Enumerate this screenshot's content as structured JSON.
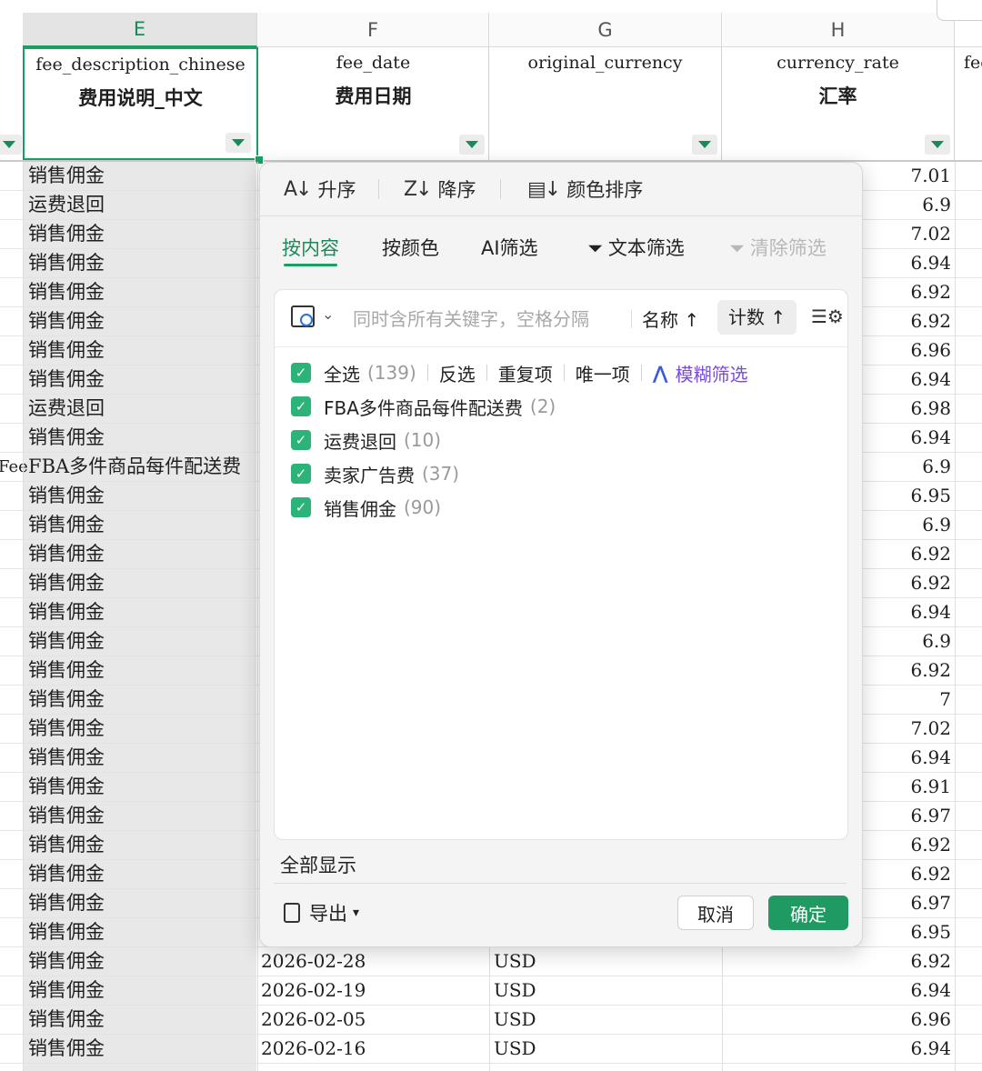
{
  "columns": {
    "E": {
      "letter": "E",
      "en": "fee_description_chinese",
      "zh": "费用说明_中文"
    },
    "F": {
      "letter": "F",
      "en": "fee_date",
      "zh": "费用日期"
    },
    "G": {
      "letter": "G",
      "en": "original_currency",
      "zh": ""
    },
    "H": {
      "letter": "H",
      "en": "currency_rate",
      "zh": "汇率"
    },
    "I": {
      "letter": "",
      "en": "fee"
    }
  },
  "rows": [
    {
      "e": "销售佣金",
      "h": "7.01"
    },
    {
      "e": "运费退回",
      "h": "6.9"
    },
    {
      "e": "销售佣金",
      "h": "7.02"
    },
    {
      "e": "销售佣金",
      "h": "6.94"
    },
    {
      "e": "销售佣金",
      "h": "6.92"
    },
    {
      "e": "销售佣金",
      "h": "6.92"
    },
    {
      "e": "销售佣金",
      "h": "6.96"
    },
    {
      "e": "销售佣金",
      "h": "6.94"
    },
    {
      "e": "运费退回",
      "h": "6.98"
    },
    {
      "e": "销售佣金",
      "h": "6.94"
    },
    {
      "a": "Fee",
      "e": "FBA多件商品每件配送费",
      "h": "6.9"
    },
    {
      "e": "销售佣金",
      "h": "6.95"
    },
    {
      "e": "销售佣金",
      "h": "6.9"
    },
    {
      "e": "销售佣金",
      "h": "6.92"
    },
    {
      "e": "销售佣金",
      "h": "6.92"
    },
    {
      "e": "销售佣金",
      "h": "6.94"
    },
    {
      "e": "销售佣金",
      "h": "6.9"
    },
    {
      "e": "销售佣金",
      "h": "6.92"
    },
    {
      "e": "销售佣金",
      "h": "7"
    },
    {
      "e": "销售佣金",
      "h": "7.02"
    },
    {
      "e": "销售佣金",
      "h": "6.94"
    },
    {
      "e": "销售佣金",
      "h": "6.91"
    },
    {
      "e": "销售佣金",
      "h": "6.97"
    },
    {
      "e": "销售佣金",
      "h": "6.92"
    },
    {
      "e": "销售佣金",
      "h": "6.92"
    },
    {
      "e": "销售佣金",
      "h": "6.97"
    },
    {
      "e": "销售佣金",
      "h": "6.95"
    },
    {
      "e": "销售佣金",
      "f": "2026-02-28",
      "g": "USD",
      "h": "6.92"
    },
    {
      "e": "销售佣金",
      "f": "2026-02-19",
      "g": "USD",
      "h": "6.94"
    },
    {
      "e": "销售佣金",
      "f": "2026-02-05",
      "g": "USD",
      "h": "6.96"
    },
    {
      "e": "销售佣金",
      "f": "2026-02-16",
      "g": "USD",
      "h": "6.94"
    }
  ],
  "filter_panel": {
    "sort_asc": "升序",
    "sort_desc": "降序",
    "sort_color": "颜色排序",
    "tabs": {
      "by_content": "按内容",
      "by_color": "按颜色",
      "ai_filter": "AI筛选",
      "text_filter": "文本筛选",
      "clear_filter": "清除筛选"
    },
    "search_placeholder": "同时含所有关键字，空格分隔",
    "sort_by_name": "名称 ↑",
    "sort_by_count": "计数 ↑",
    "select_all": {
      "label": "全选",
      "count": "(139)"
    },
    "invert": "反选",
    "duplicates": "重复项",
    "unique": "唯一项",
    "fuzzy": "模糊筛选",
    "items": [
      {
        "label": "FBA多件商品每件配送费",
        "count": "(2)"
      },
      {
        "label": "运费退回",
        "count": "(10)"
      },
      {
        "label": "卖家广告费",
        "count": "(37)"
      },
      {
        "label": "销售佣金",
        "count": "(90)"
      }
    ],
    "show_all": "全部显示",
    "export": "导出",
    "cancel": "取消",
    "confirm": "确定"
  }
}
